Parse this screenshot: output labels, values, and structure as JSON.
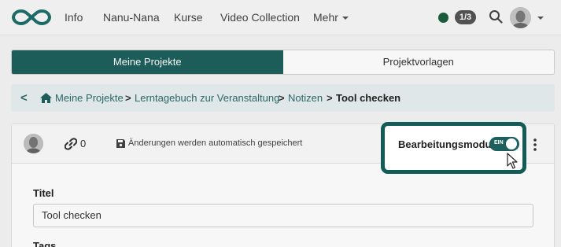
{
  "nav": {
    "items": [
      "Info",
      "Nanu-Nana",
      "Kurse",
      "Video Collection",
      "Mehr"
    ],
    "counter": "1/3"
  },
  "tabs": [
    "Meine Projekte",
    "Projektvorlagen"
  ],
  "breadcrumb": {
    "items": [
      "Meine Projekte",
      "Lerntagebuch zur Veranstaltung",
      "Notizen"
    ],
    "current": "Tool checken"
  },
  "toolbar": {
    "link_count": "0",
    "autosave": "Änderungen werden automatisch gespeichert",
    "edit_mode_label": "Bearbeitungsmodus",
    "toggle_label": "EIN"
  },
  "form": {
    "title_label": "Titel",
    "title_value": "Tool checken",
    "tags_label": "Tags"
  },
  "colors": {
    "accent": "#1d5f5c",
    "highlight_border": "#145b58"
  }
}
